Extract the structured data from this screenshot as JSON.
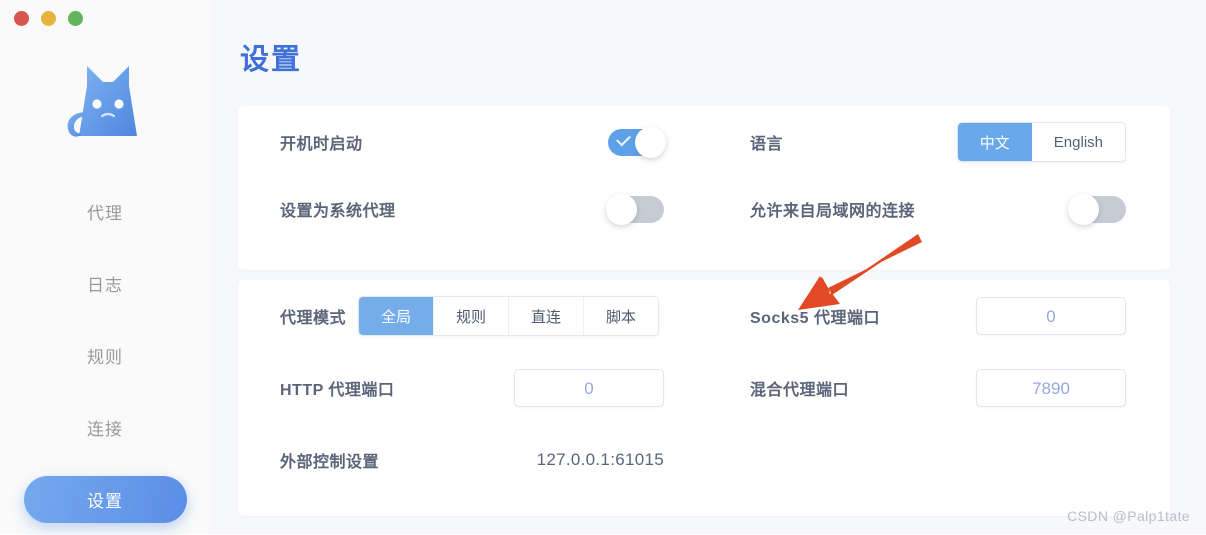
{
  "window": {
    "traffic_lights": [
      {
        "name": "close",
        "color": "#d9534f"
      },
      {
        "name": "minimize",
        "color": "#e6b33c"
      },
      {
        "name": "maximize",
        "color": "#64b45c"
      }
    ]
  },
  "sidebar": {
    "logo_name": "clash-cat-logo",
    "items": [
      {
        "label": "代理",
        "active": false
      },
      {
        "label": "日志",
        "active": false
      },
      {
        "label": "规则",
        "active": false
      },
      {
        "label": "连接",
        "active": false
      },
      {
        "label": "设置",
        "active": true
      }
    ]
  },
  "page": {
    "title": "设置"
  },
  "card_general": {
    "rows": [
      {
        "label": "开机时启动",
        "control": "toggle",
        "state": "on"
      },
      {
        "label": "语言",
        "control": "segmented",
        "options": [
          "中文",
          "English"
        ],
        "selected": "中文"
      },
      {
        "label": "设置为系统代理",
        "control": "toggle",
        "state": "off"
      },
      {
        "label": "允许来自局域网的连接",
        "control": "toggle",
        "state": "off"
      }
    ]
  },
  "card_proxy": {
    "mode": {
      "label": "代理模式",
      "tabs": [
        "全局",
        "规则",
        "直连",
        "脚本"
      ],
      "selected": "全局"
    },
    "socks5": {
      "label": "Socks5 代理端口",
      "value": "0"
    },
    "http": {
      "label": "HTTP 代理端口",
      "value": "0"
    },
    "mixed": {
      "label": "混合代理端口",
      "value": "7890"
    },
    "external": {
      "label": "外部控制设置",
      "value": "127.0.0.1:61015"
    }
  },
  "annotation": {
    "name": "red-arrow",
    "color": "#e04a25",
    "points_to": "Socks5 代理端口"
  },
  "watermark": {
    "text": "CSDN @Palp1tate"
  },
  "colors": {
    "accent_blue": "#5da2e8",
    "title_blue": "#3f71d7",
    "label_gray": "#5b6479",
    "input_text": "#97a7e0",
    "content_bg": "#f7f8fb",
    "sidebar_bg": "#fafafa"
  }
}
